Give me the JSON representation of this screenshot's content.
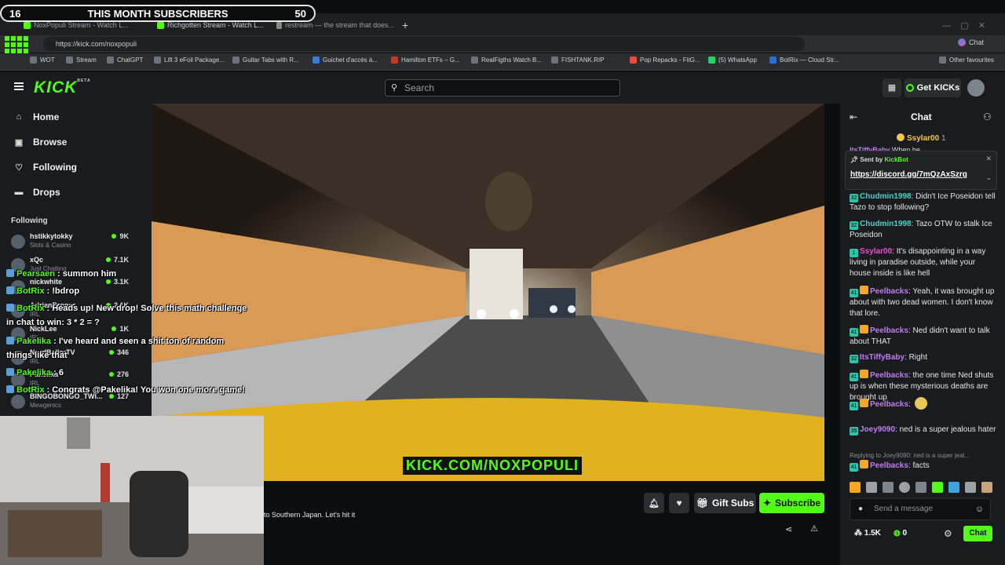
{
  "overlay": {
    "sub_left": "16",
    "sub_title": "THIS MONTH SUBSCRIBERS",
    "sub_right": "50"
  },
  "browser": {
    "tabs": [
      {
        "label": "NoxPopuli Stream - Watch L..."
      },
      {
        "label": "Richgotten Stream - Watch L..."
      },
      {
        "label": "restream — the stream that does..."
      }
    ],
    "url": "https://kick.com/noxpopuli",
    "bookmarks": [
      "WOT",
      "Stream",
      "ChatGPT",
      "Lift 3 eFoil Package...",
      "Guitar Tabs with R...",
      "Guichet d'accès à...",
      "Hamilton ETFs – G...",
      "RealFigths Watch B...",
      "FISHTANK.RIP",
      "Pop Repacks - FitG...",
      "(5) WhatsApp",
      "BotRix — Cloud Str..."
    ],
    "other_favourites": "Other favourites",
    "copilot": "Chat"
  },
  "header": {
    "logo": "KICK",
    "beta": "BETA",
    "search_placeholder": "Search",
    "get_kicks": "Get KICKs"
  },
  "sidebar": {
    "nav": [
      {
        "label": "Home",
        "icon": "home-icon"
      },
      {
        "label": "Browse",
        "icon": "browse-icon"
      },
      {
        "label": "Following",
        "icon": "heart-icon"
      },
      {
        "label": "Drops",
        "icon": "drops-icon"
      }
    ],
    "following_title": "Following",
    "following": [
      {
        "name": "hstikkytokky",
        "category": "Slots & Casino",
        "viewers": "9K"
      },
      {
        "name": "xQc",
        "category": "Just Chatting",
        "viewers": "7.1K"
      },
      {
        "name": "nickwhite",
        "category": "",
        "viewers": "3.1K"
      },
      {
        "name": "AdrianBroner",
        "category": "IRL",
        "viewers": "2.1K"
      },
      {
        "name": "NickLee",
        "category": "IRL",
        "viewers": "1K"
      },
      {
        "name": "NordBallerTV",
        "category": "IRL",
        "viewers": "346"
      },
      {
        "name": "Pakelika",
        "category": "IRL",
        "viewers": "276"
      },
      {
        "name": "BINGOBONGO_TWI...",
        "category": "Mewgenics",
        "viewers": "127"
      }
    ]
  },
  "overlay_chat": [
    {
      "user": "Pearsaen",
      "sep": " : ",
      "text": "summon him"
    },
    {
      "user": "BotRix",
      "sep": " : ",
      "text": "!bdrop"
    },
    {
      "user": "BotRix",
      "sep": " : ",
      "text": "Heads up! New drop! Solve this math challenge in chat to win: 3 * 2 = ?"
    },
    {
      "user": "Pakelika",
      "sep": " : ",
      "text": "I've heard and seen a shit ton of random things like that"
    },
    {
      "user": "Pakelika",
      "sep": " : ",
      "text": "6"
    },
    {
      "user": "BotRix",
      "sep": " : ",
      "text": "Congrats @Pakelika! You won one more game!"
    }
  ],
  "video": {
    "watermark": "KICK.COM/NOXPOPULI"
  },
  "stream": {
    "title_fragment": "to Southern Japan. Let's hit it",
    "gift_subs": "Gift Subs",
    "subscribe": "Subscribe"
  },
  "chat": {
    "title": "Chat",
    "top_gifter": "Ssylar00",
    "top_gifter_count": "1",
    "pinned": {
      "sent_by": "Sent by",
      "bot": "KickBot",
      "link": "https://discord.gg/7mQzAxSzrg",
      "hidden_user": "ItsTiffyBaby",
      "hidden_text": "When he"
    },
    "messages": [
      {
        "badge": "32",
        "user": "Chudmin1998",
        "color": "#3fd6c5",
        "text": "Didn't Ice Poseidon tell Tazo to stop following?"
      },
      {
        "badge": "32",
        "user": "Chudmin1998",
        "color": "#3fd6c5",
        "text": "Tazo OTW to stalk Ice Poseidon"
      },
      {
        "badge": "1",
        "user": "Ssylar00",
        "color": "#e94fd1",
        "text": "It's disappointing in a way living in paradise outside, while your house inside is like hell"
      },
      {
        "badge": "41",
        "user": "Peelbacks",
        "color": "#c07cf2",
        "text": "Yeah, it was brought up about with two dead women. I don't know that lore."
      },
      {
        "badge": "41",
        "user": "Peelbacks",
        "color": "#c07cf2",
        "text": "Ned didn't want to talk about THAT"
      },
      {
        "badge": "32",
        "user": "ItsTiffyBaby",
        "color": "#c07cf2",
        "text": "Right"
      },
      {
        "badge": "41",
        "user": "Peelbacks",
        "color": "#c07cf2",
        "text": "the one time Ned shuts up is when these mysterious deaths are brought up"
      },
      {
        "badge": "41",
        "user": "Peelbacks",
        "color": "#c07cf2",
        "text": ""
      },
      {
        "badge": "35",
        "user": "Joey9090",
        "color": "#c07cf2",
        "text": "ned is a super jealous hater"
      },
      {
        "badge": "41",
        "user": "Peelbacks",
        "color": "#c07cf2",
        "text": "facts"
      }
    ],
    "reply_note": "Replying to Joey9090: ned is a super jeal...",
    "send_placeholder": "Send a message",
    "kicks_count": "1.5K",
    "points": "0",
    "chat_button": "Chat"
  }
}
